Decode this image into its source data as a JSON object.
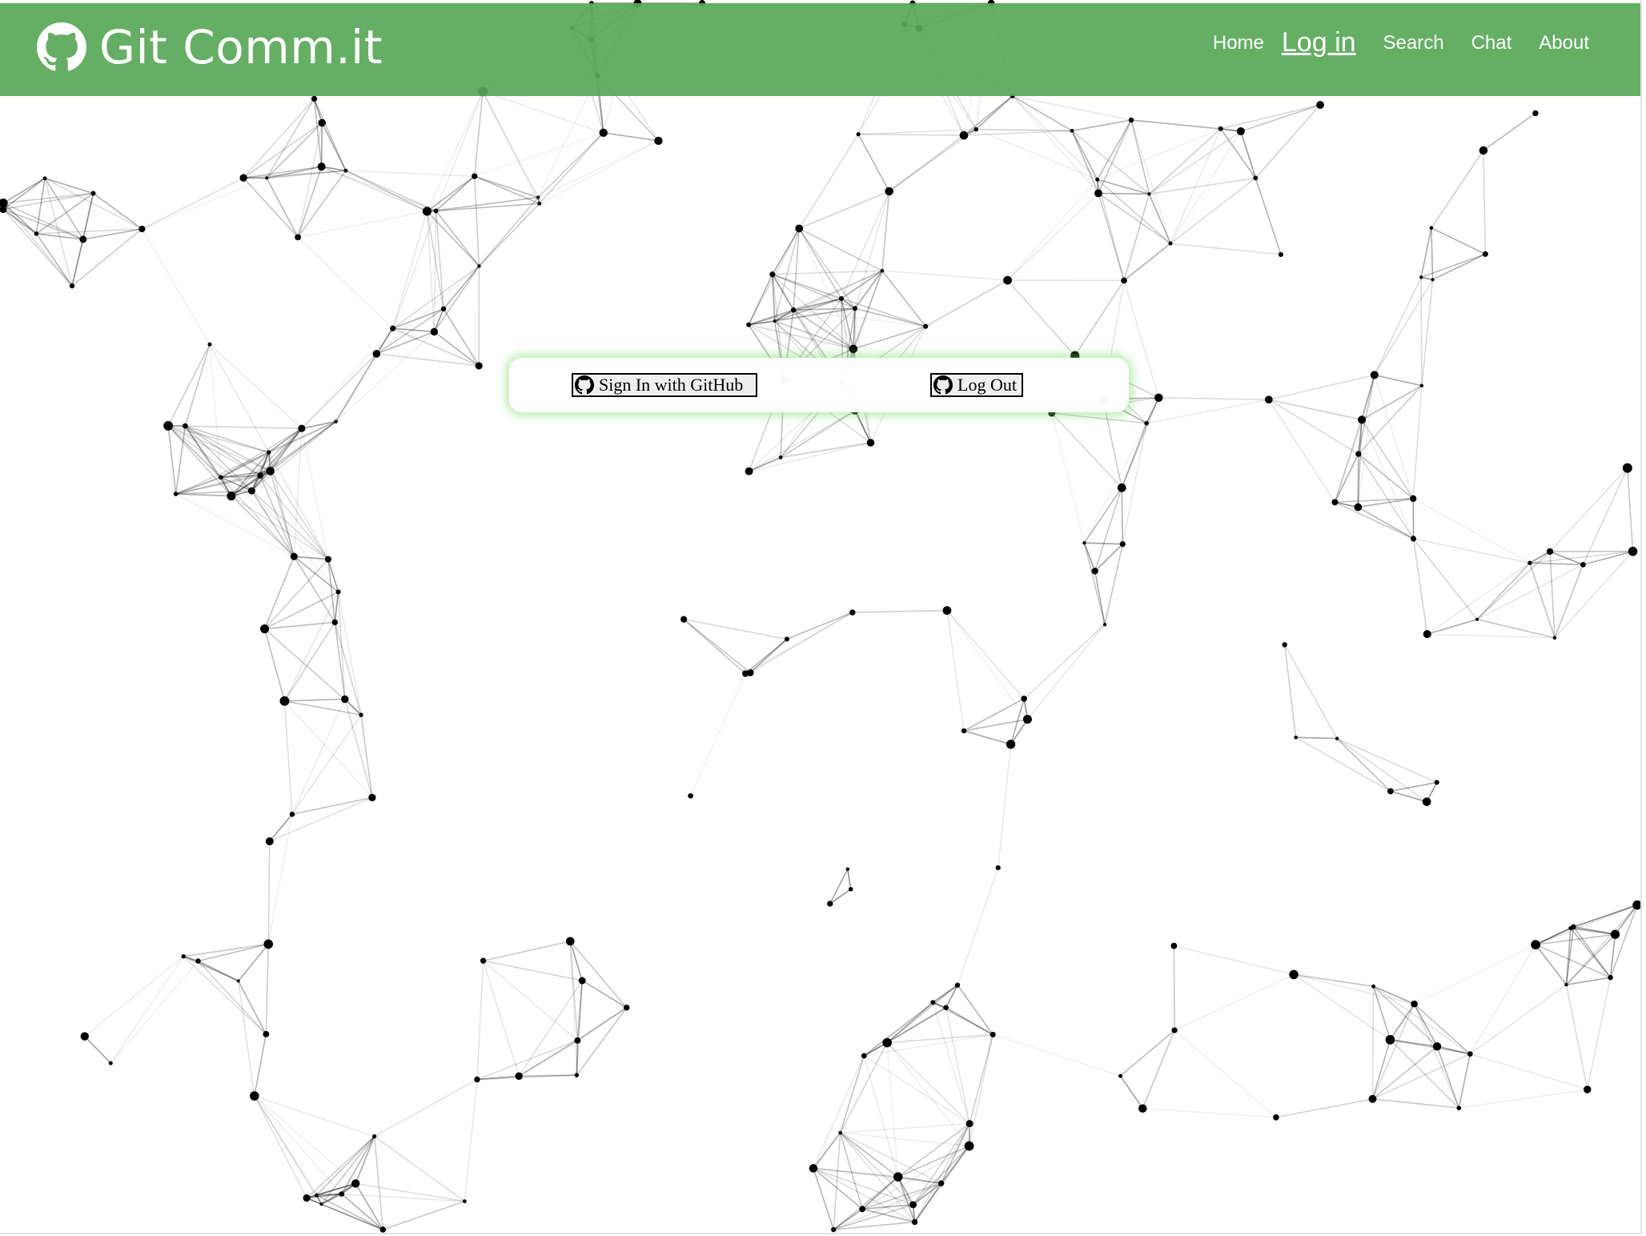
{
  "app": {
    "brand_name": "Git Comm.it",
    "brand_icon": "github-octocat-icon",
    "accent_color": "#5aa95a"
  },
  "nav": {
    "items": [
      {
        "label": "Home",
        "active": false
      },
      {
        "label": "Log in",
        "active": true
      },
      {
        "label": "Search",
        "active": false
      },
      {
        "label": "Chat",
        "active": false
      },
      {
        "label": "About",
        "active": false
      }
    ]
  },
  "auth": {
    "signin_label": "Sign In with GitHub",
    "logout_label": "Log Out",
    "button_icon": "github-octocat-icon"
  }
}
